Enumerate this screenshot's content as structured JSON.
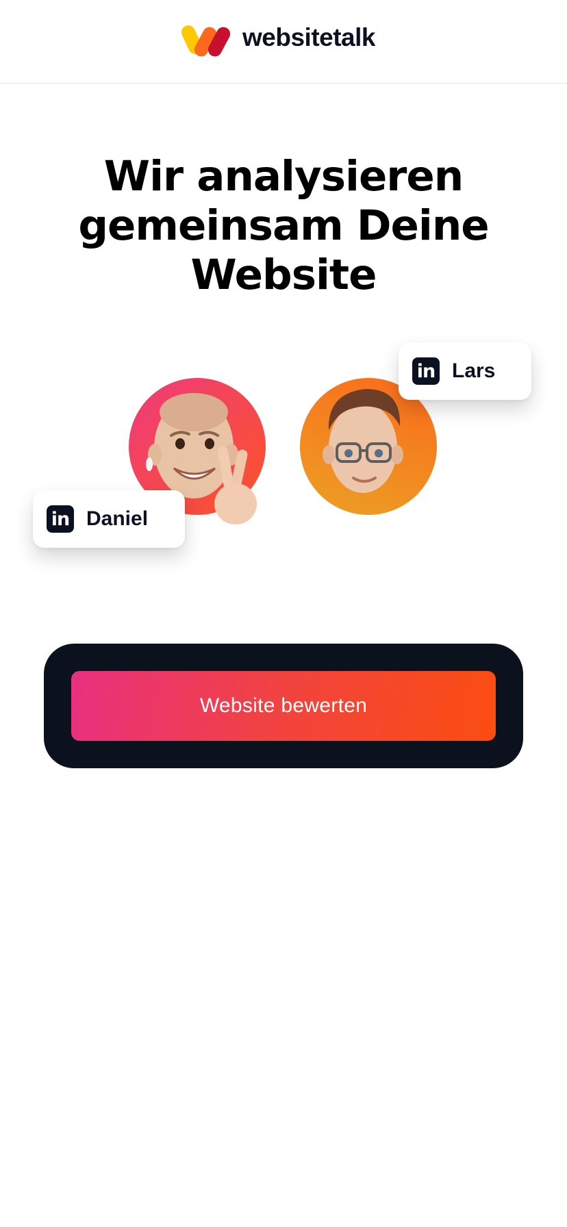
{
  "brand": {
    "name": "websitetalk",
    "logo_colors": [
      "#ffc800",
      "#fb6a1a",
      "#c8102e"
    ]
  },
  "hero": {
    "headline_line1": "Wir analysieren",
    "headline_line2": "gemeinsam Deine",
    "headline_line3": "Website"
  },
  "people": [
    {
      "name": "Daniel",
      "icon": "linkedin-icon",
      "icon_text": "in",
      "avatar": "memoji-peace-sign"
    },
    {
      "name": "Lars",
      "icon": "linkedin-icon",
      "icon_text": "in",
      "avatar": "memoji-glasses"
    }
  ],
  "cta": {
    "label": "Website bewerten",
    "gradient_start": "#e8307f",
    "gradient_end": "#fb4d10",
    "frame_color": "#0b111d"
  }
}
